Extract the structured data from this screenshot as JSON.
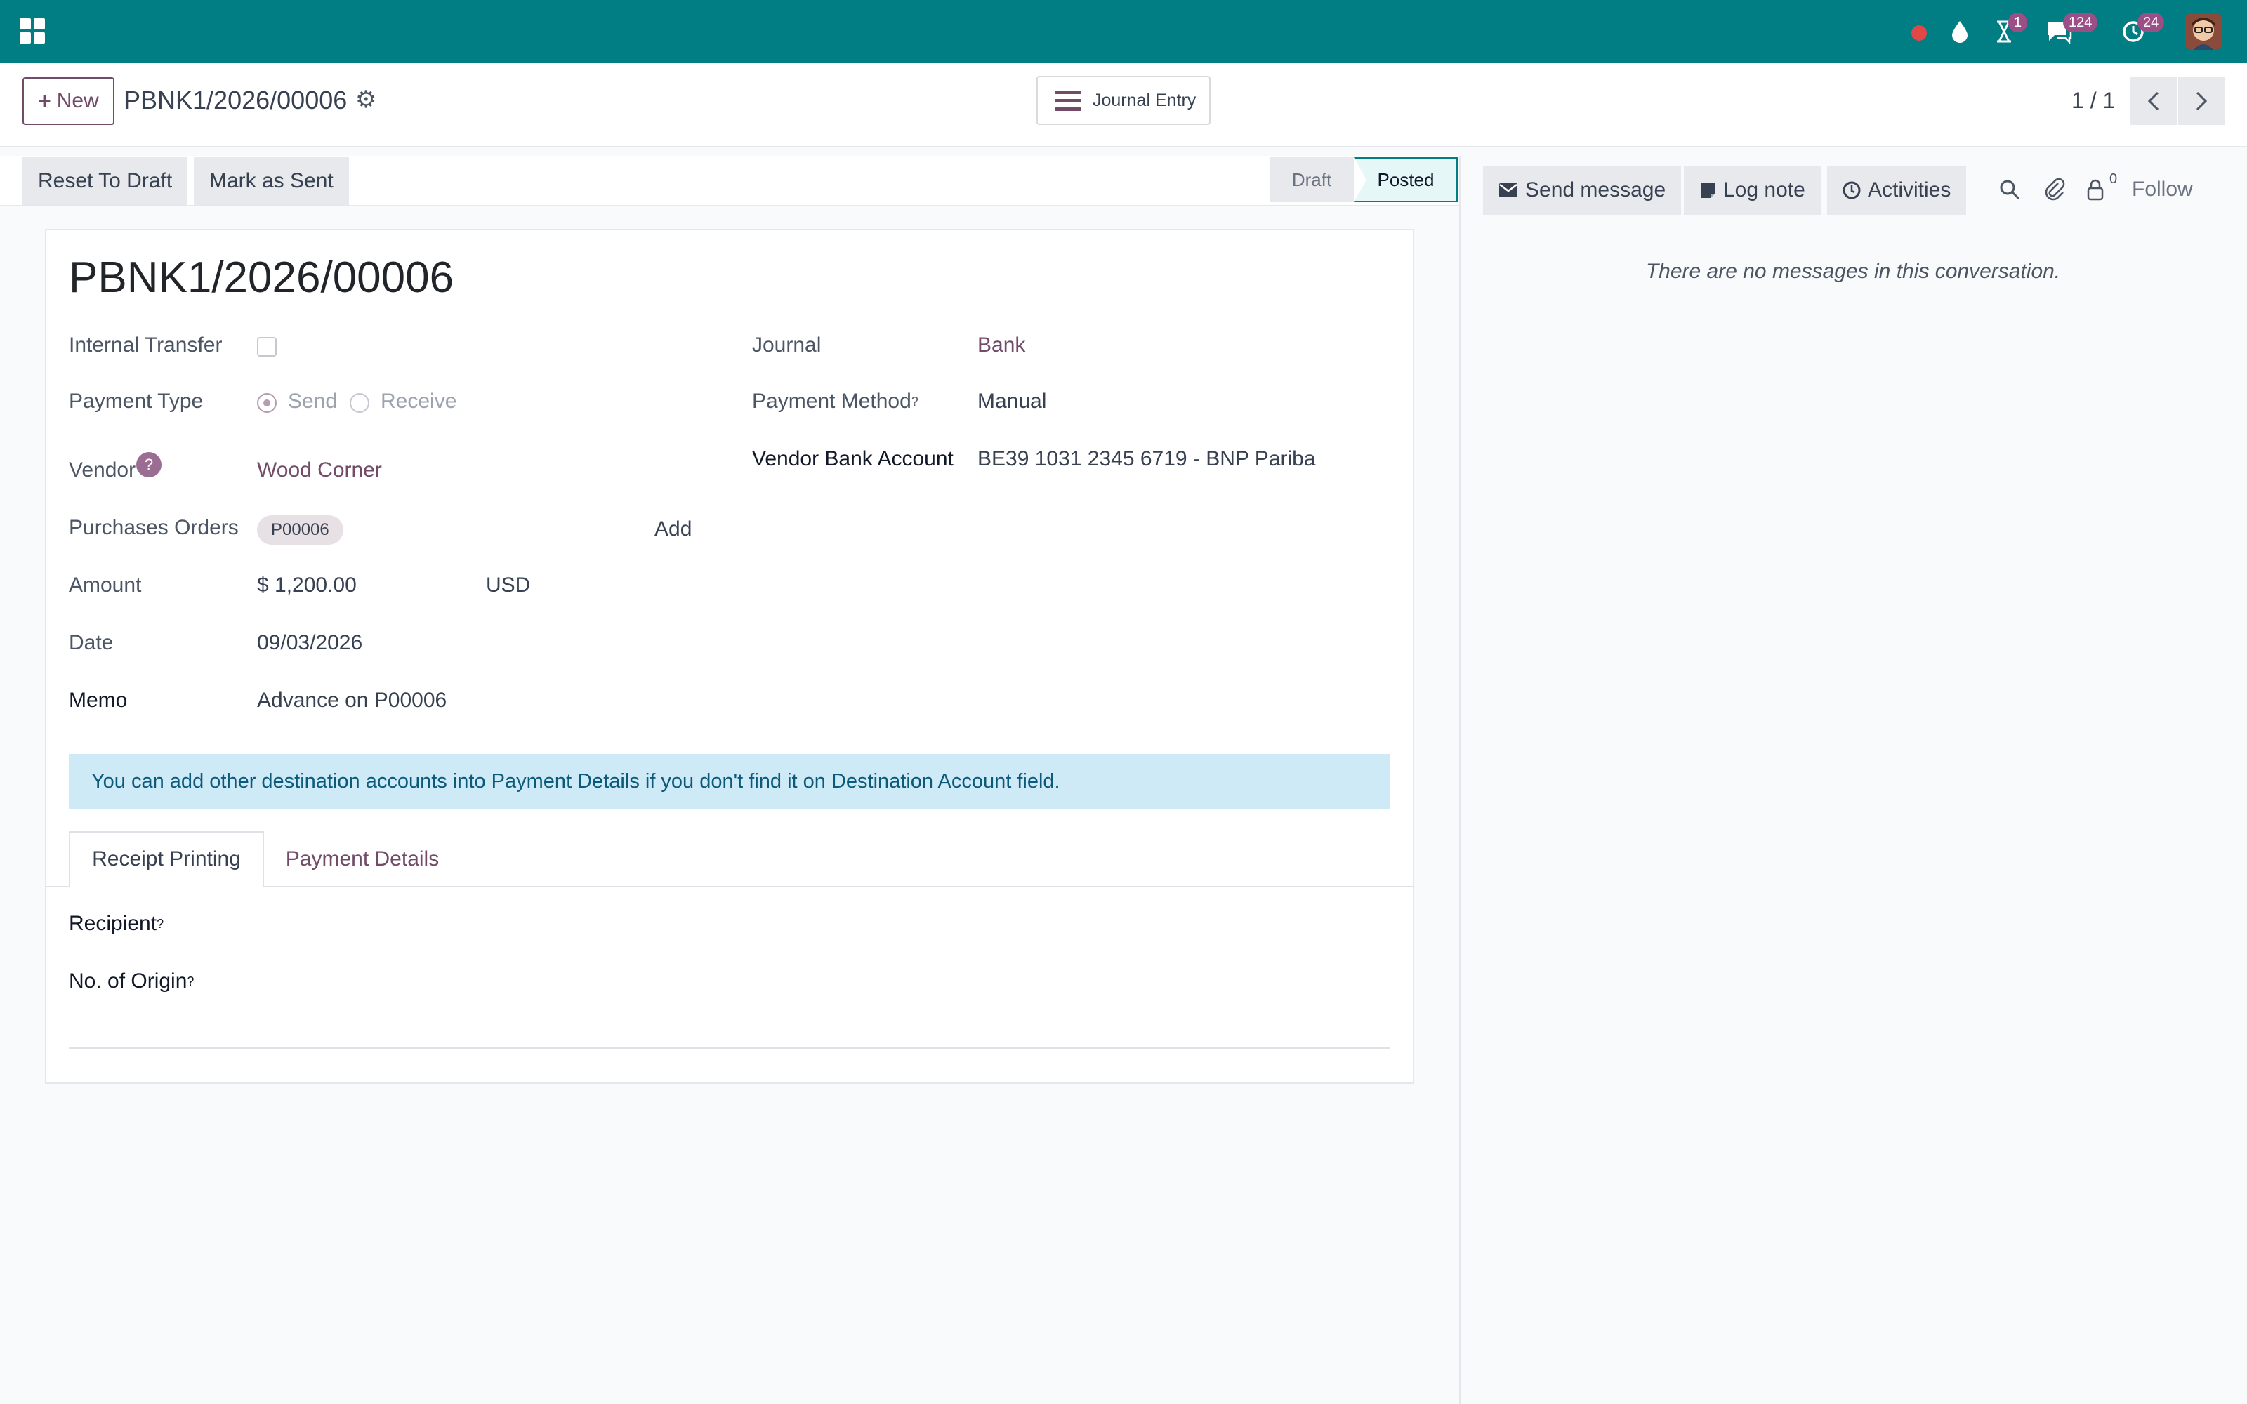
{
  "topbar": {
    "chat_count": "124",
    "activity_count": "1",
    "clock_count": "24"
  },
  "control_panel": {
    "new_label": "New",
    "record_name": "PBNK1/2026/00006",
    "journal_entry_label": "Journal Entry",
    "pager": "1 / 1"
  },
  "statusbar": {
    "reset_label": "Reset To Draft",
    "mark_sent_label": "Mark as Sent",
    "stages": [
      "Draft",
      "Posted"
    ]
  },
  "form": {
    "title": "PBNK1/2026/00006",
    "internal_transfer_label": "Internal Transfer",
    "payment_type_label": "Payment Type",
    "send_label": "Send",
    "receive_label": "Receive",
    "vendor_label": "Vendor",
    "help_mark": "?",
    "vendor_value": "Wood Corner",
    "po_label": "Purchases Orders",
    "po_tag": "P00006",
    "add_label": "Add",
    "amount_label": "Amount",
    "amount_value": "$ 1,200.00",
    "currency": "USD",
    "date_label": "Date",
    "date_value": "09/03/2026",
    "memo_label": "Memo",
    "memo_value": "Advance on P00006",
    "journal_label": "Journal",
    "journal_value": "Bank",
    "payment_method_label": "Payment Method",
    "payment_method_value": "Manual",
    "vendor_bank_label": "Vendor Bank Account",
    "vendor_bank_value": "BE39 1031 2345 6719 - BNP Pariba",
    "superscript": "?",
    "alert": "You can add other destination accounts into Payment Details if you don't find it on Destination Account field.",
    "tabs": [
      "Receipt Printing",
      "Payment Details"
    ],
    "recipient_label": "Recipient",
    "origin_label": "No. of Origin"
  },
  "chatter": {
    "send_message": "Send message",
    "log_note": "Log note",
    "activities": "Activities",
    "followers_count": "0",
    "follow_label": "Follow",
    "empty_message": "There are no messages in this conversation."
  },
  "colors": {
    "topbar": "#017e84",
    "brand": "#714b67",
    "alert_bg": "#cfeaf7"
  }
}
